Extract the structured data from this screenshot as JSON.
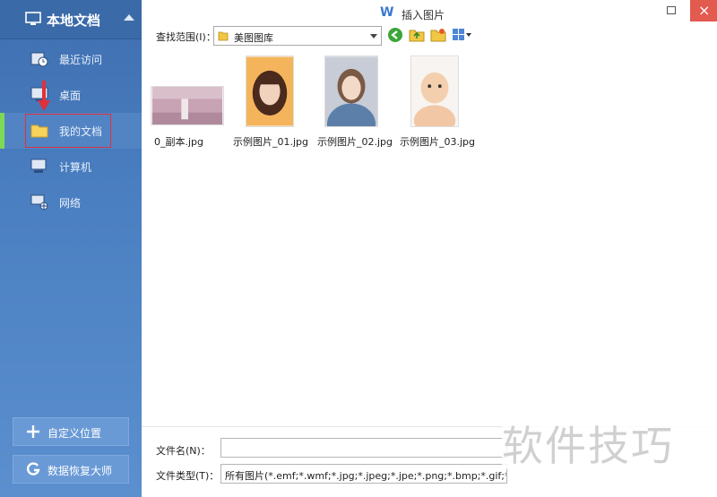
{
  "sidebar": {
    "title": "本地文档",
    "items": [
      {
        "label": "最近访问",
        "icon": "recent-icon"
      },
      {
        "label": "桌面",
        "icon": "desktop-icon"
      },
      {
        "label": "我的文档",
        "icon": "folder-icon"
      },
      {
        "label": "计算机",
        "icon": "computer-icon"
      },
      {
        "label": "网络",
        "icon": "network-icon"
      }
    ],
    "active_item": "我的文档",
    "custom_location_label": "自定义位置",
    "data_recovery_label": "数据恢复大师"
  },
  "dialog": {
    "title": "插入图片",
    "logo": "W",
    "lookin_label": "查找范围(I)：",
    "lookin_value": "美图图库",
    "files": [
      {
        "name": "0_副本.jpg"
      },
      {
        "name": "示例图片_01.jpg"
      },
      {
        "name": "示例图片_02.jpg"
      },
      {
        "name": "示例图片_03.jpg"
      }
    ],
    "filename_label": "文件名(N)：",
    "filename_value": "",
    "filetype_label": "文件类型(T)：",
    "filetype_value": "所有图片(*.emf;*.wmf;*.jpg;*.jpeg;*.jpe;*.png;*.bmp;*.gif;*.tif;*.tiff;*."
  },
  "watermark": "软件技巧",
  "colors": {
    "sidebar": "#4a7fc1",
    "active_marker": "#7ed957",
    "highlight": "#e0303a",
    "close_button": "#e35a4f"
  }
}
